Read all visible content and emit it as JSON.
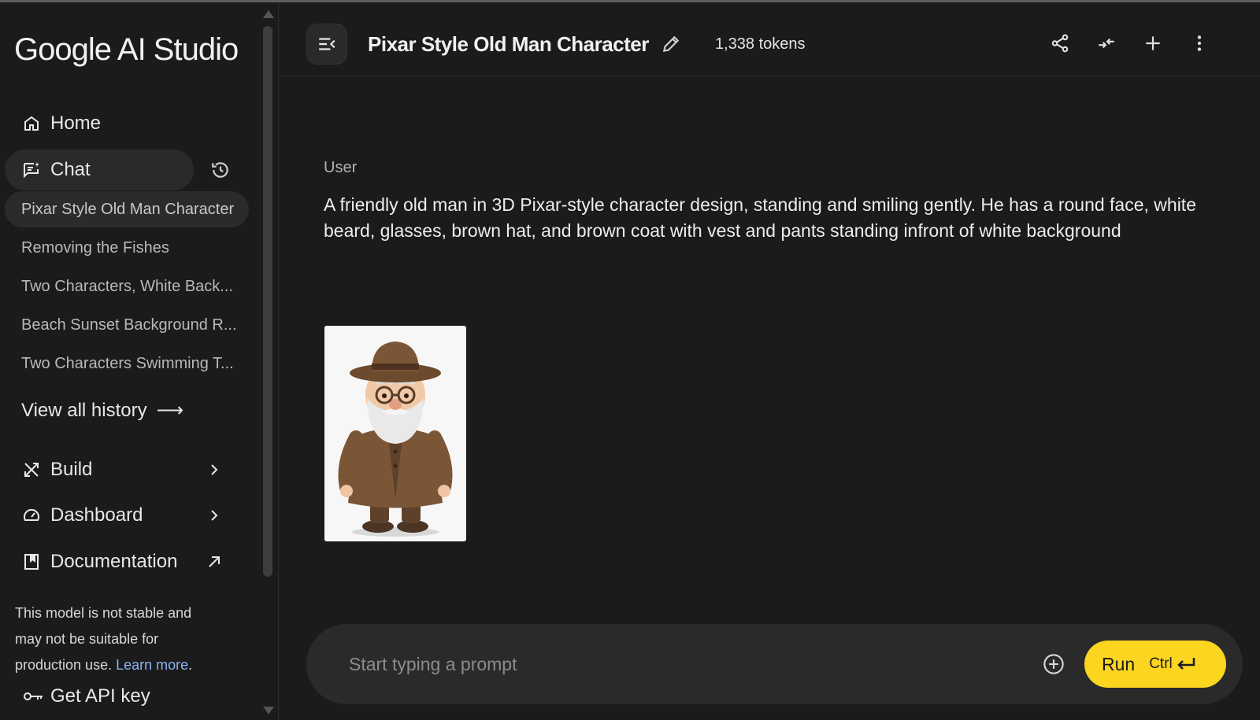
{
  "app": {
    "logo": "Google AI Studio"
  },
  "sidebar": {
    "home_label": "Home",
    "chat_label": "Chat",
    "history": [
      "Pixar Style Old Man Character",
      "Removing the Fishes",
      "Two Characters, White Back...",
      "Beach Sunset Background R...",
      "Two Characters Swimming T..."
    ],
    "view_all_label": "View all history",
    "view_all_arrow": "⟶",
    "build_label": "Build",
    "dashboard_label": "Dashboard",
    "documentation_label": "Documentation",
    "disclaimer_text": "This model is not stable and may not be suitable for production use.",
    "learn_more": "Learn more",
    "disclaimer_end": ".",
    "api_key_label": "Get API key"
  },
  "header": {
    "title": "Pixar Style Old Man Character",
    "tokens": "1,338 tokens"
  },
  "conversation": {
    "role": "User",
    "text": "A friendly old man in 3D Pixar-style character design, standing and smiling gently. He has a round face, white beard, glasses, brown hat, and brown coat with vest and pants standing infront of white background"
  },
  "composer": {
    "placeholder": "Start typing a prompt",
    "run_label": "Run",
    "shortcut": "Ctrl"
  },
  "colors": {
    "background": "#1b1b1b",
    "accent": "#fbd520",
    "link": "#8ab4f8"
  }
}
